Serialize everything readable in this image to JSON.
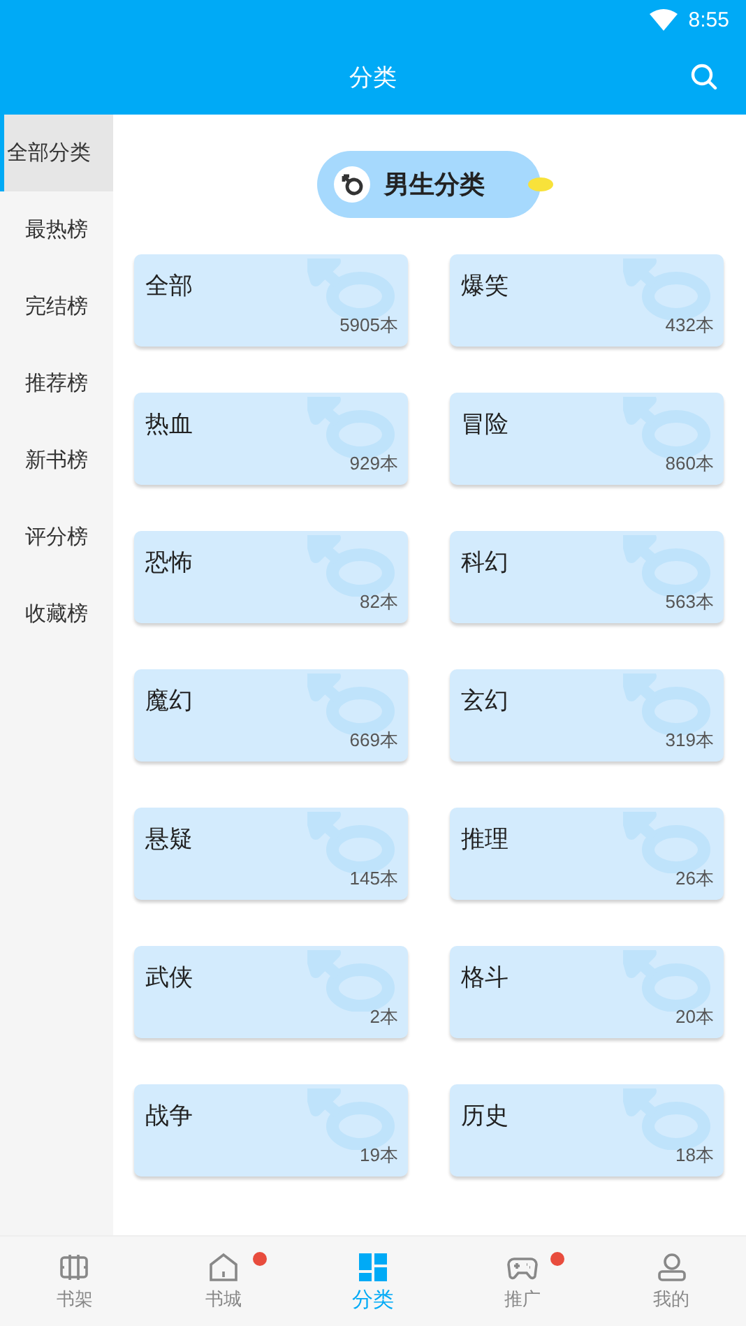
{
  "status_bar": {
    "time": "8:55"
  },
  "app_bar": {
    "title": "分类"
  },
  "sidebar": {
    "items": [
      {
        "label": "全部分类",
        "selected": true
      },
      {
        "label": "最热榜",
        "selected": false
      },
      {
        "label": "完结榜",
        "selected": false
      },
      {
        "label": "推荐榜",
        "selected": false
      },
      {
        "label": "新书榜",
        "selected": false
      },
      {
        "label": "评分榜",
        "selected": false
      },
      {
        "label": "收藏榜",
        "selected": false
      }
    ]
  },
  "gender_header": {
    "label": "男生分类"
  },
  "categories": [
    {
      "name": "全部",
      "count": "5905本"
    },
    {
      "name": "爆笑",
      "count": "432本"
    },
    {
      "name": "热血",
      "count": "929本"
    },
    {
      "name": "冒险",
      "count": "860本"
    },
    {
      "name": "恐怖",
      "count": "82本"
    },
    {
      "name": "科幻",
      "count": "563本"
    },
    {
      "name": "魔幻",
      "count": "669本"
    },
    {
      "name": "玄幻",
      "count": "319本"
    },
    {
      "name": "悬疑",
      "count": "145本"
    },
    {
      "name": "推理",
      "count": "26本"
    },
    {
      "name": "武侠",
      "count": "2本"
    },
    {
      "name": "格斗",
      "count": "20本"
    },
    {
      "name": "战争",
      "count": "19本"
    },
    {
      "name": "历史",
      "count": "18本"
    }
  ],
  "bottom_nav": [
    {
      "kind": "shelf",
      "label": "书架",
      "selected": false,
      "dot": false
    },
    {
      "kind": "home",
      "label": "书城",
      "selected": false,
      "dot": true
    },
    {
      "kind": "grid",
      "label": "分类",
      "selected": true,
      "dot": false
    },
    {
      "kind": "gamepad",
      "label": "推广",
      "selected": false,
      "dot": true
    },
    {
      "kind": "person",
      "label": "我的",
      "selected": false,
      "dot": false
    }
  ]
}
